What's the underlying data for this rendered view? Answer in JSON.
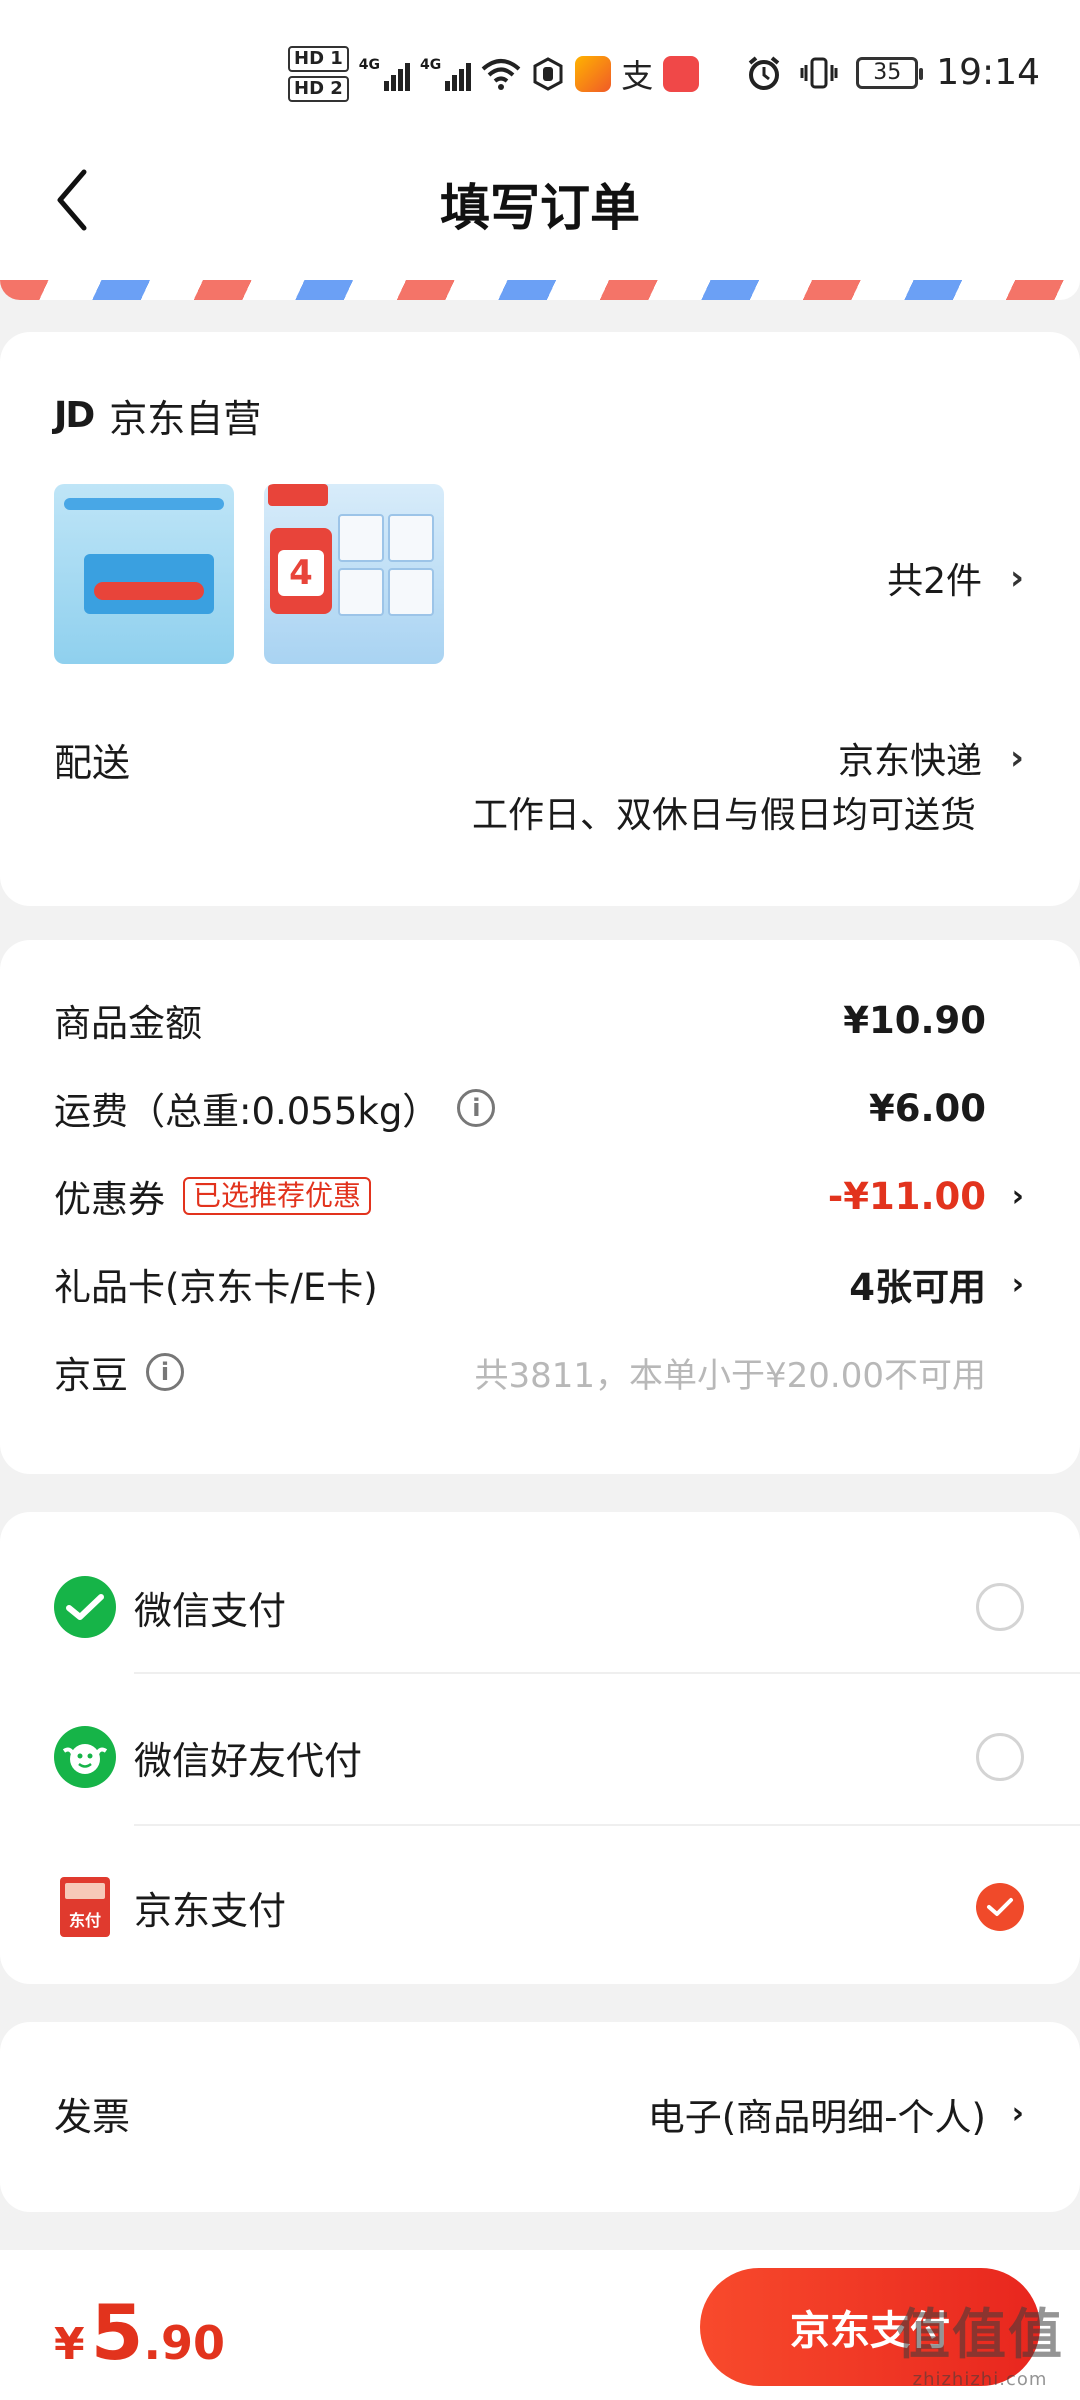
{
  "status_bar": {
    "hd1": "HD 1",
    "hd2": "HD 2",
    "net1": "4G",
    "net2": "4G",
    "alipay_glyph": "支",
    "battery": "35",
    "time": "19:14",
    "icons": [
      "signal-icon",
      "wifi-icon",
      "hand-icon",
      "app-icon-618",
      "alipay-icon",
      "app-icon-red",
      "alarm-icon",
      "vibrate-icon"
    ]
  },
  "nav": {
    "title": "填写订单",
    "back_icon": "chevron-left-icon"
  },
  "shop": {
    "logo": "JD",
    "name": "京东自营",
    "item_count": "共2件",
    "delivery_label": "配送",
    "delivery_value": "京东快递",
    "delivery_note": "工作日、双休日与假日均可送货",
    "thumb2_badge": "4"
  },
  "price": {
    "goods_label": "商品金额",
    "goods_value": "¥10.90",
    "freight_label": "运费（总重:0.055kg）",
    "freight_value": "¥6.00",
    "coupon_label": "优惠券",
    "coupon_tag": "已选推荐优惠",
    "coupon_value": "-¥11.00",
    "giftcard_label": "礼品卡(京东卡/E卡)",
    "giftcard_value": "4张可用",
    "beans_label": "京豆",
    "beans_value": "共3811，本单小于¥20.00不可用"
  },
  "payment": {
    "options": [
      {
        "label": "微信支付",
        "selected": false
      },
      {
        "label": "微信好友代付",
        "selected": false
      },
      {
        "label": "京东支付",
        "selected": true
      }
    ],
    "jdpay_icon_text": "东付"
  },
  "invoice": {
    "label": "发票",
    "value": "电子(商品明细-个人)"
  },
  "bottom": {
    "currency": "¥",
    "total_int": "5",
    "total_dec": ".90",
    "pay_button": "京东支付"
  },
  "watermark": {
    "text": "值值值",
    "sub": "zhizhizhi.com"
  },
  "colors": {
    "accent": "#e2331d",
    "wechat": "#16b448",
    "button": "#f84a2c"
  }
}
